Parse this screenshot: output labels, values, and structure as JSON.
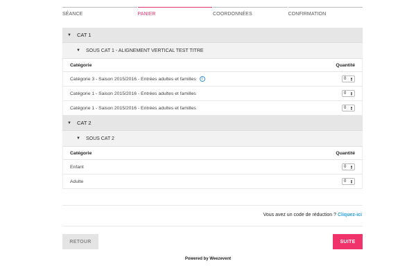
{
  "steps": [
    {
      "label": "SÉANCE"
    },
    {
      "label": "PANIER"
    },
    {
      "label": "COORDONNÉES"
    },
    {
      "label": "CONFIRMATION"
    }
  ],
  "active_step": "PANIER",
  "categories": [
    {
      "title": "CAT 1",
      "subcategory": "SOUS CAT 1 - ALIGNEMENT VERTICAL TEST TITRE",
      "col_category": "Catégorie",
      "col_quantity": "Quantité",
      "rows": [
        {
          "label": "Catégorie 3 - Saison 2015/2016 - Entrées adultes et familles",
          "qty": "0",
          "info": "i"
        },
        {
          "label": "Catégorie 1 - Saison 2015/2016 - Entrées adultes et familles",
          "qty": "0"
        },
        {
          "label": "Catégorie 1 - Saison 2015/2016 - Entrées adultes et familles",
          "qty": "0"
        }
      ]
    },
    {
      "title": "CAT 2",
      "subcategory": "SOUS CAT 2",
      "col_category": "Catégorie",
      "col_quantity": "Quantité",
      "rows": [
        {
          "label": "Enfant",
          "qty": "0"
        },
        {
          "label": "Adulte",
          "qty": "0"
        }
      ]
    }
  ],
  "promo": {
    "text": "Vous avez un code de réduction ?",
    "link": "Cliquez-ici"
  },
  "buttons": {
    "back": "RETOUR",
    "next": "SUITE"
  },
  "footer": "Powered by Weezevent",
  "colors": {
    "accent": "#f0336a",
    "link": "#2a9fd8"
  }
}
